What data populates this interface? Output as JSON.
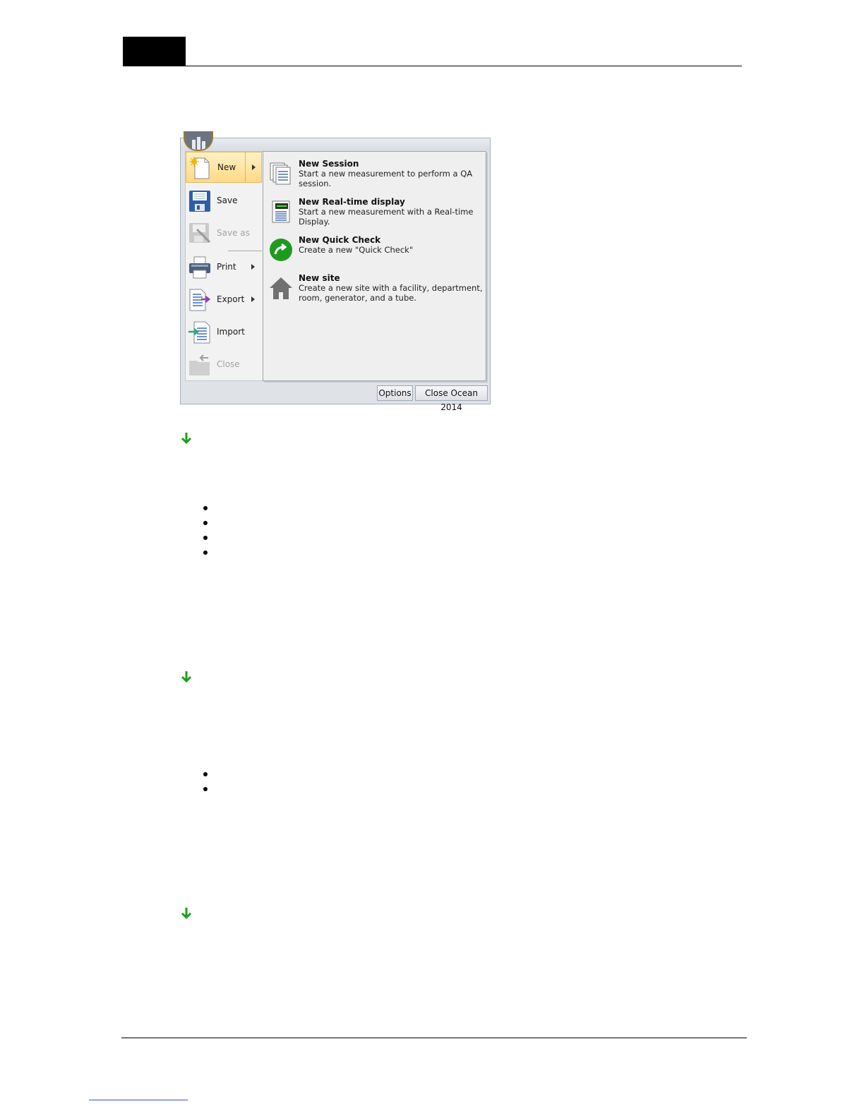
{
  "menu": {
    "items": [
      {
        "label": "New",
        "icon": "new-document-icon",
        "selected": true,
        "submenu": true,
        "enabled": true
      },
      {
        "label": "Save",
        "icon": "floppy-disk-icon",
        "enabled": true
      },
      {
        "label": "Save as",
        "icon": "save-as-icon",
        "enabled": false
      },
      {
        "label": "Print",
        "icon": "printer-icon",
        "submenu": true,
        "enabled": true
      },
      {
        "label": "Export",
        "icon": "export-icon",
        "submenu": true,
        "enabled": true
      },
      {
        "label": "Import",
        "icon": "import-icon",
        "enabled": true
      },
      {
        "label": "Close",
        "icon": "close-folder-icon",
        "enabled": false
      }
    ],
    "submenu": [
      {
        "title": "New Session",
        "desc": "Start a new measurement to perform a QA session.",
        "icon": "session-pages-icon"
      },
      {
        "title": "New Real-time display",
        "desc": "Start a new measurement with a Real-time Display.",
        "icon": "realtime-display-icon"
      },
      {
        "title": "New Quick Check",
        "desc": "Create a new \"Quick Check\"",
        "icon": "quick-check-arrow-icon"
      },
      {
        "title": "New site",
        "desc": "Create a new site with a facility, department, room, generator, and a tube.",
        "icon": "house-icon"
      }
    ],
    "footer": {
      "options": "Options",
      "close_app": "Close Ocean 2014"
    }
  },
  "colors": {
    "selected_bg": "#ffd985",
    "arrow_green": "#1aa01a",
    "quick_check_green": "#1f9a1f"
  }
}
